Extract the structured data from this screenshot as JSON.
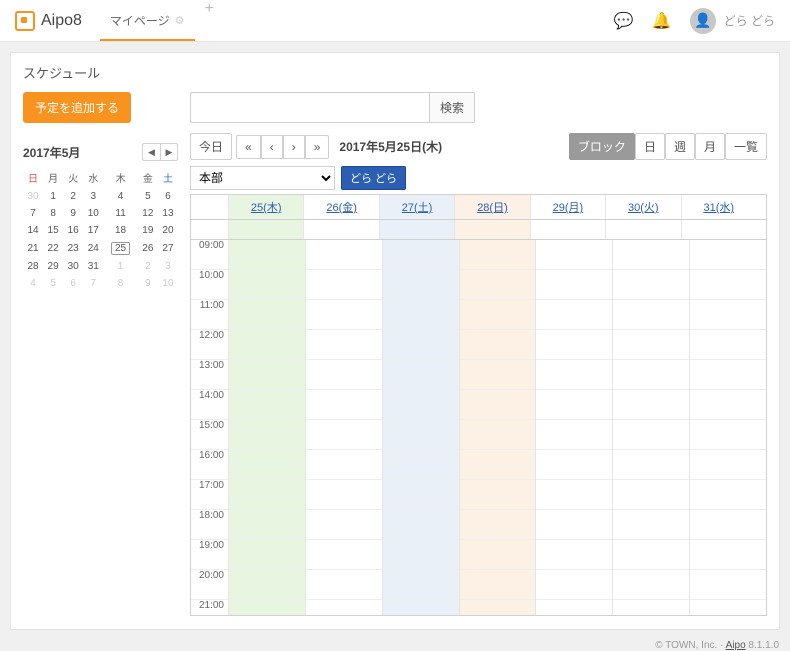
{
  "header": {
    "app_name": "Aipo8",
    "tab_mypage": "マイページ",
    "user_name": "どら どら"
  },
  "page_title": "スケジュール",
  "add_button": "予定を追加する",
  "search_button": "検索",
  "mini_cal": {
    "title": "2017年5月",
    "dow": [
      "日",
      "月",
      "火",
      "水",
      "木",
      "金",
      "土"
    ],
    "weeks": [
      [
        {
          "d": "30",
          "o": true
        },
        {
          "d": "1"
        },
        {
          "d": "2"
        },
        {
          "d": "3"
        },
        {
          "d": "4"
        },
        {
          "d": "5"
        },
        {
          "d": "6"
        }
      ],
      [
        {
          "d": "7"
        },
        {
          "d": "8"
        },
        {
          "d": "9"
        },
        {
          "d": "10"
        },
        {
          "d": "11"
        },
        {
          "d": "12"
        },
        {
          "d": "13"
        }
      ],
      [
        {
          "d": "14"
        },
        {
          "d": "15"
        },
        {
          "d": "16"
        },
        {
          "d": "17"
        },
        {
          "d": "18"
        },
        {
          "d": "19"
        },
        {
          "d": "20"
        }
      ],
      [
        {
          "d": "21"
        },
        {
          "d": "22"
        },
        {
          "d": "23"
        },
        {
          "d": "24"
        },
        {
          "d": "25",
          "today": true
        },
        {
          "d": "26"
        },
        {
          "d": "27"
        }
      ],
      [
        {
          "d": "28"
        },
        {
          "d": "29"
        },
        {
          "d": "30"
        },
        {
          "d": "31"
        },
        {
          "d": "1",
          "o": true
        },
        {
          "d": "2",
          "o": true
        },
        {
          "d": "3",
          "o": true
        }
      ],
      [
        {
          "d": "4",
          "o": true
        },
        {
          "d": "5",
          "o": true
        },
        {
          "d": "6",
          "o": true
        },
        {
          "d": "7",
          "o": true
        },
        {
          "d": "8",
          "o": true
        },
        {
          "d": "9",
          "o": true
        },
        {
          "d": "10",
          "o": true
        }
      ]
    ]
  },
  "toolbar": {
    "today": "今日",
    "date_label": "2017年5月25日(木)",
    "views": {
      "block": "ブロック",
      "day": "日",
      "week": "週",
      "month": "月",
      "list": "一覧"
    }
  },
  "filter": {
    "group_selected": "本部",
    "user_badge": "どら どら"
  },
  "days": [
    {
      "label": "25(木)",
      "cls": "c-thu"
    },
    {
      "label": "26(金)",
      "cls": ""
    },
    {
      "label": "27(土)",
      "cls": "c-sat"
    },
    {
      "label": "28(日)",
      "cls": "c-sun"
    },
    {
      "label": "29(月)",
      "cls": ""
    },
    {
      "label": "30(火)",
      "cls": ""
    },
    {
      "label": "31(水)",
      "cls": ""
    }
  ],
  "hours": [
    "09:00",
    "10:00",
    "11:00",
    "12:00",
    "13:00",
    "14:00",
    "15:00",
    "16:00",
    "17:00",
    "18:00",
    "19:00",
    "20:00",
    "21:00"
  ],
  "footer": {
    "copyright": "© TOWN, Inc.  ·  ",
    "link_text": "Aipo",
    "version": " 8.1.1.0"
  }
}
